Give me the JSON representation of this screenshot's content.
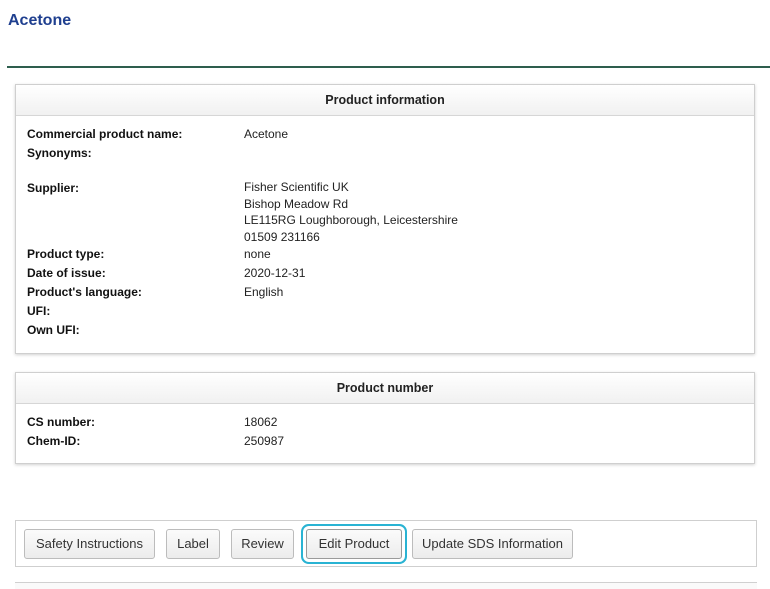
{
  "page": {
    "title": "Acetone"
  },
  "product_info": {
    "header": "Product information",
    "commercial_name_label": "Commercial product name:",
    "commercial_name_value": "Acetone",
    "synonyms_label": "Synonyms:",
    "synonyms_value": "",
    "supplier_label": "Supplier:",
    "supplier_lines": [
      "Fisher Scientific UK",
      "Bishop Meadow Rd",
      "LE115RG Loughborough, Leicestershire",
      "01509 231166"
    ],
    "product_type_label": "Product type:",
    "product_type_value": "none",
    "date_of_issue_label": "Date of issue:",
    "date_of_issue_value": "2020-12-31",
    "language_label": "Product's language:",
    "language_value": "English",
    "ufi_label": "UFI:",
    "ufi_value": "",
    "own_ufi_label": "Own UFI:",
    "own_ufi_value": ""
  },
  "product_number": {
    "header": "Product number",
    "cs_label": "CS number:",
    "cs_value": "18062",
    "chem_label": "Chem-ID:",
    "chem_value": "250987"
  },
  "actions": {
    "safety": "Safety Instructions",
    "label": "Label",
    "review": "Review",
    "edit": "Edit Product",
    "update_sds": "Update SDS Information"
  }
}
